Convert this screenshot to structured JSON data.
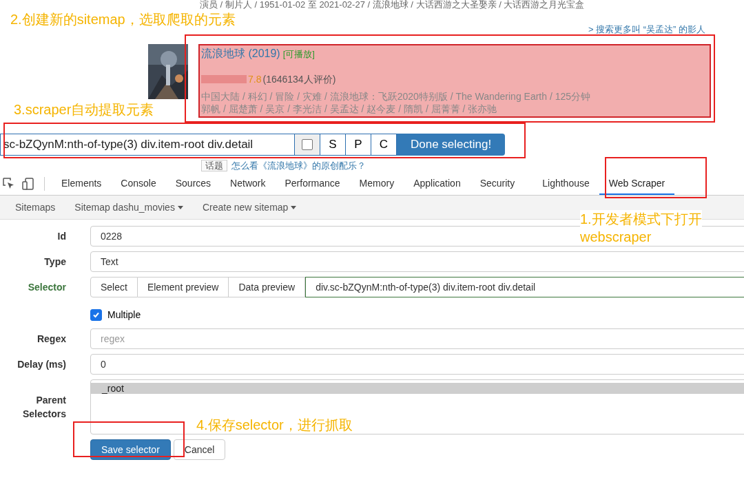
{
  "page": {
    "credits_line": "演员 / 制片人 / 1951-01-02 至 2021-02-27 / 流浪地球 / 大话西游之大圣娶亲 / 大话西游之月光宝盒",
    "more_link": "> 搜索更多叫 “吴孟达” 的影人",
    "result": {
      "title": "流浪地球 (2019)",
      "badge": "[可播放]",
      "rating": "7.8",
      "votes": "(1646134人评价)",
      "info": "中国大陆 / 科幻 / 冒险 / 灾难 / 流浪地球：飞跃2020特别版 / The Wandering Earth / 125分钟",
      "cast": "郭帆 / 屈楚萧 / 吴京 / 李光洁 / 吴孟达 / 赵今麦 / 隋凯 / 屈菁菁 / 张亦驰",
      "highlighted": true
    },
    "topic": {
      "tag": "话题",
      "link": "怎么看《流浪地球》的原创配乐？"
    }
  },
  "selection_toolbar": {
    "selector_value": "sc-bZQynM:nth-of-type(3) div.item-root div.detail",
    "checked": false,
    "buttons": [
      "S",
      "P",
      "C"
    ],
    "done_button": "Done selecting!"
  },
  "devtools": {
    "tabs": [
      {
        "label": "Elements",
        "selected": false
      },
      {
        "label": "Console",
        "selected": false
      },
      {
        "label": "Sources",
        "selected": false
      },
      {
        "label": "Network",
        "selected": false
      },
      {
        "label": "Performance",
        "selected": false
      },
      {
        "label": "Memory",
        "selected": false
      },
      {
        "label": "Application",
        "selected": false
      },
      {
        "label": "Security",
        "selected": false
      },
      {
        "label": "Lighthouse",
        "selected": false
      },
      {
        "label": "Web Scraper",
        "selected": true
      }
    ],
    "subnav": [
      {
        "label": "Sitemaps",
        "dropdown": false
      },
      {
        "label": "Sitemap dashu_movies",
        "dropdown": true
      },
      {
        "label": "Create new sitemap",
        "dropdown": true
      }
    ],
    "form": {
      "fields": [
        {
          "kind": "input",
          "label": "Id",
          "value": "0228"
        },
        {
          "kind": "select",
          "label": "Type",
          "value": "Text"
        },
        {
          "kind": "selector",
          "label": "Selector",
          "valid": true,
          "buttons": [
            "Select",
            "Element preview",
            "Data preview"
          ],
          "value": "div.sc-bZQynM:nth-of-type(3) div.item-root div.detail"
        },
        {
          "kind": "checkbox",
          "label": "Multiple",
          "checked": true
        },
        {
          "kind": "input",
          "label": "Regex",
          "placeholder": "regex"
        },
        {
          "kind": "input",
          "label": "Delay (ms)",
          "value": "0"
        },
        {
          "kind": "multiselect",
          "label": "Parent Selectors",
          "options": [
            {
              "label": "_root",
              "selected": true
            }
          ]
        }
      ],
      "actions": [
        {
          "label": "Save selector",
          "primary": true
        },
        {
          "label": "Cancel",
          "primary": false
        }
      ]
    }
  },
  "annotations": [
    {
      "text": "2.创建新的sitemap，选取爬取的元素"
    },
    {
      "text": "3.scraper自动提取元素"
    },
    {
      "text": "1.开发者模式下打开\nwebscraper"
    },
    {
      "text": "4.保存selector，进行抓取"
    }
  ]
}
